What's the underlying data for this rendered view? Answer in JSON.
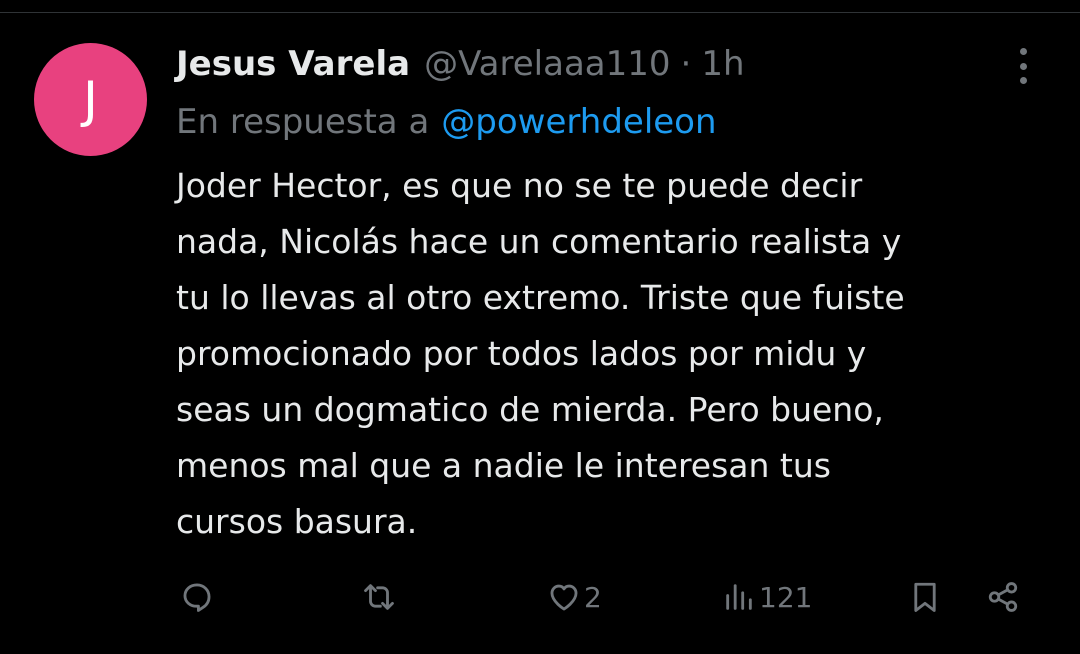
{
  "tweet": {
    "avatar_initial": "J",
    "avatar_color": "#e8417f",
    "display_name": "Jesus Varela",
    "handle": "@Varelaaa110",
    "separator": "·",
    "time": "1h",
    "reply_prefix": "En respuesta a",
    "reply_to": "@powerhdeleon",
    "text_lines": [
      "Joder Hector, es que no se te puede decir",
      "nada, Nicolás hace un comentario realista y",
      "tu lo llevas al otro extremo. Triste que fuiste",
      "promocionado por todos lados por midu y",
      "seas un dogmatico de mierda. Pero bueno,",
      "menos mal que a nadie le interesan tus",
      "cursos basura."
    ]
  },
  "actions": {
    "reply_icon": "reply-bubble-icon",
    "retweet_icon": "retweet-icon",
    "like_icon": "heart-icon",
    "like_count": "2",
    "views_icon": "views-bar-chart-icon",
    "views_count": "121",
    "bookmark_icon": "bookmark-icon",
    "share_icon": "share-icon"
  },
  "colors": {
    "background": "#000000",
    "text_primary": "#e7e9ea",
    "text_secondary": "#71767b",
    "link": "#1d9bf0",
    "divider": "#2f3336"
  }
}
